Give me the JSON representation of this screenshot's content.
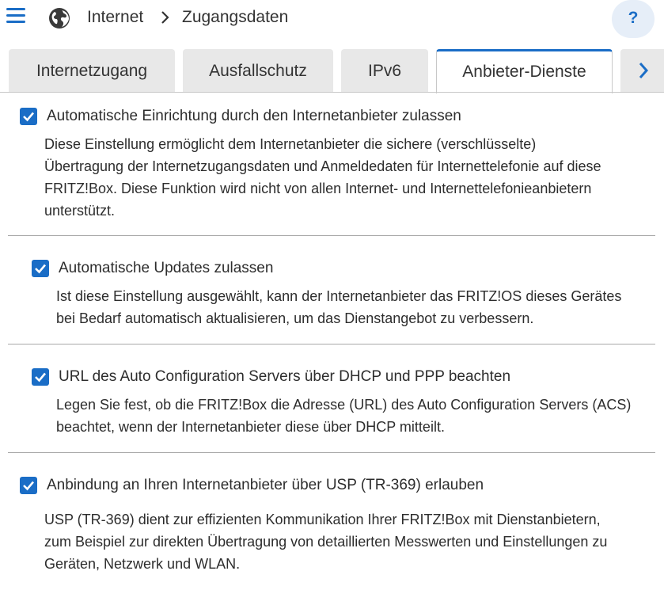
{
  "header": {
    "breadcrumb": [
      "Internet",
      "Zugangsdaten"
    ],
    "help_label": "?"
  },
  "tabs": [
    {
      "label": "Internetzugang"
    },
    {
      "label": "Ausfallschutz"
    },
    {
      "label": "IPv6"
    },
    {
      "label": "Anbieter-Dienste",
      "active": true
    }
  ],
  "colors": {
    "accent": "#1a6dc6",
    "tab_inactive": "#e8e8e8",
    "divider": "#a9a9a9"
  },
  "options": [
    {
      "checked": true,
      "label": "Automatische Einrichtung durch den Internetanbieter zulassen",
      "description": [
        "Diese Einstellung ermöglicht dem Internetanbieter die sichere (verschlüsselte)",
        "Übertragung der Internetzugangsdaten und Anmeldedaten für Internettelefonie auf diese",
        "FRITZ!Box. Diese Funktion wird nicht von allen Internet- und Internettelefonieanbietern",
        "unterstützt."
      ]
    },
    {
      "checked": true,
      "label": "Automatische Updates zulassen",
      "description": [
        "Ist diese Einstellung ausgewählt, kann der Internetanbieter das FRITZ!OS dieses Gerätes",
        "bei Bedarf automatisch aktualisieren, um das Dienstangebot zu verbessern."
      ]
    },
    {
      "checked": true,
      "label": "URL des Auto Configuration Servers über DHCP und PPP beachten",
      "description": [
        "Legen Sie fest, ob die FRITZ!Box die Adresse (URL) des Auto Configuration Servers (ACS)",
        "beachtet, wenn der Internetanbieter diese über DHCP mitteilt."
      ]
    },
    {
      "checked": true,
      "label": "Anbindung an Ihren Internetanbieter über USP (TR-369) erlauben",
      "description": [
        "USP (TR-369) dient zur effizienten Kommunikation Ihrer FRITZ!Box mit Dienstanbietern,",
        "zum Beispiel zur direkten Übertragung von detaillierten Messwerten und Einstellungen zu",
        "Geräten, Netzwerk und WLAN."
      ]
    }
  ]
}
